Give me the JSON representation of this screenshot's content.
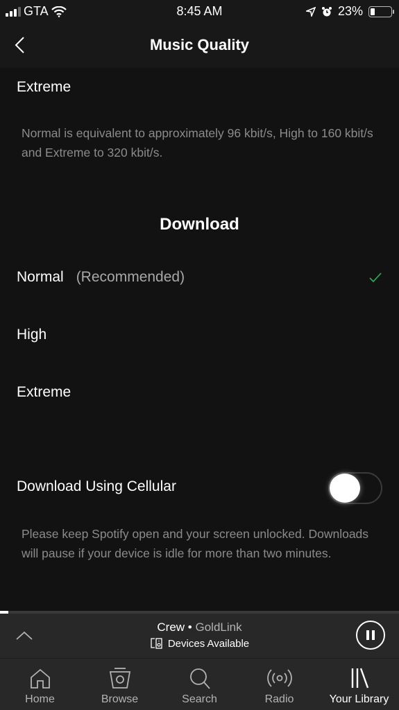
{
  "status_bar": {
    "carrier": "GTA",
    "time": "8:45 AM",
    "battery_percent_label": "23%",
    "battery_level": 0.23
  },
  "header": {
    "title": "Music Quality",
    "back_icon": "chevron-left-icon"
  },
  "streaming": {
    "last_option": "Extreme",
    "info": "Normal is equivalent to approximately 96 kbit/s, High to 160 kbit/s and Extreme to 320 kbit/s."
  },
  "download": {
    "section_title": "Download",
    "options": [
      {
        "label": "Normal",
        "sub": "(Recommended)",
        "selected": true
      },
      {
        "label": "High",
        "sub": "",
        "selected": false
      },
      {
        "label": "Extreme",
        "sub": "",
        "selected": false
      }
    ],
    "cellular": {
      "label": "Download Using Cellular",
      "enabled": false
    },
    "info": "Please keep Spotify open and your screen unlocked. Downloads will pause if your device is idle for more than two minutes."
  },
  "colors": {
    "accent": "#1db954",
    "background": "#121212",
    "bar": "#282828"
  },
  "now_playing": {
    "track": "Crew",
    "separator": " • ",
    "artist": "GoldLink",
    "devices_label": "Devices Available",
    "progress": 0.02
  },
  "tabs": [
    {
      "label": "Home",
      "icon": "home-icon",
      "active": false
    },
    {
      "label": "Browse",
      "icon": "browse-icon",
      "active": false
    },
    {
      "label": "Search",
      "icon": "search-icon",
      "active": false
    },
    {
      "label": "Radio",
      "icon": "radio-icon",
      "active": false
    },
    {
      "label": "Your Library",
      "icon": "library-icon",
      "active": true
    }
  ]
}
